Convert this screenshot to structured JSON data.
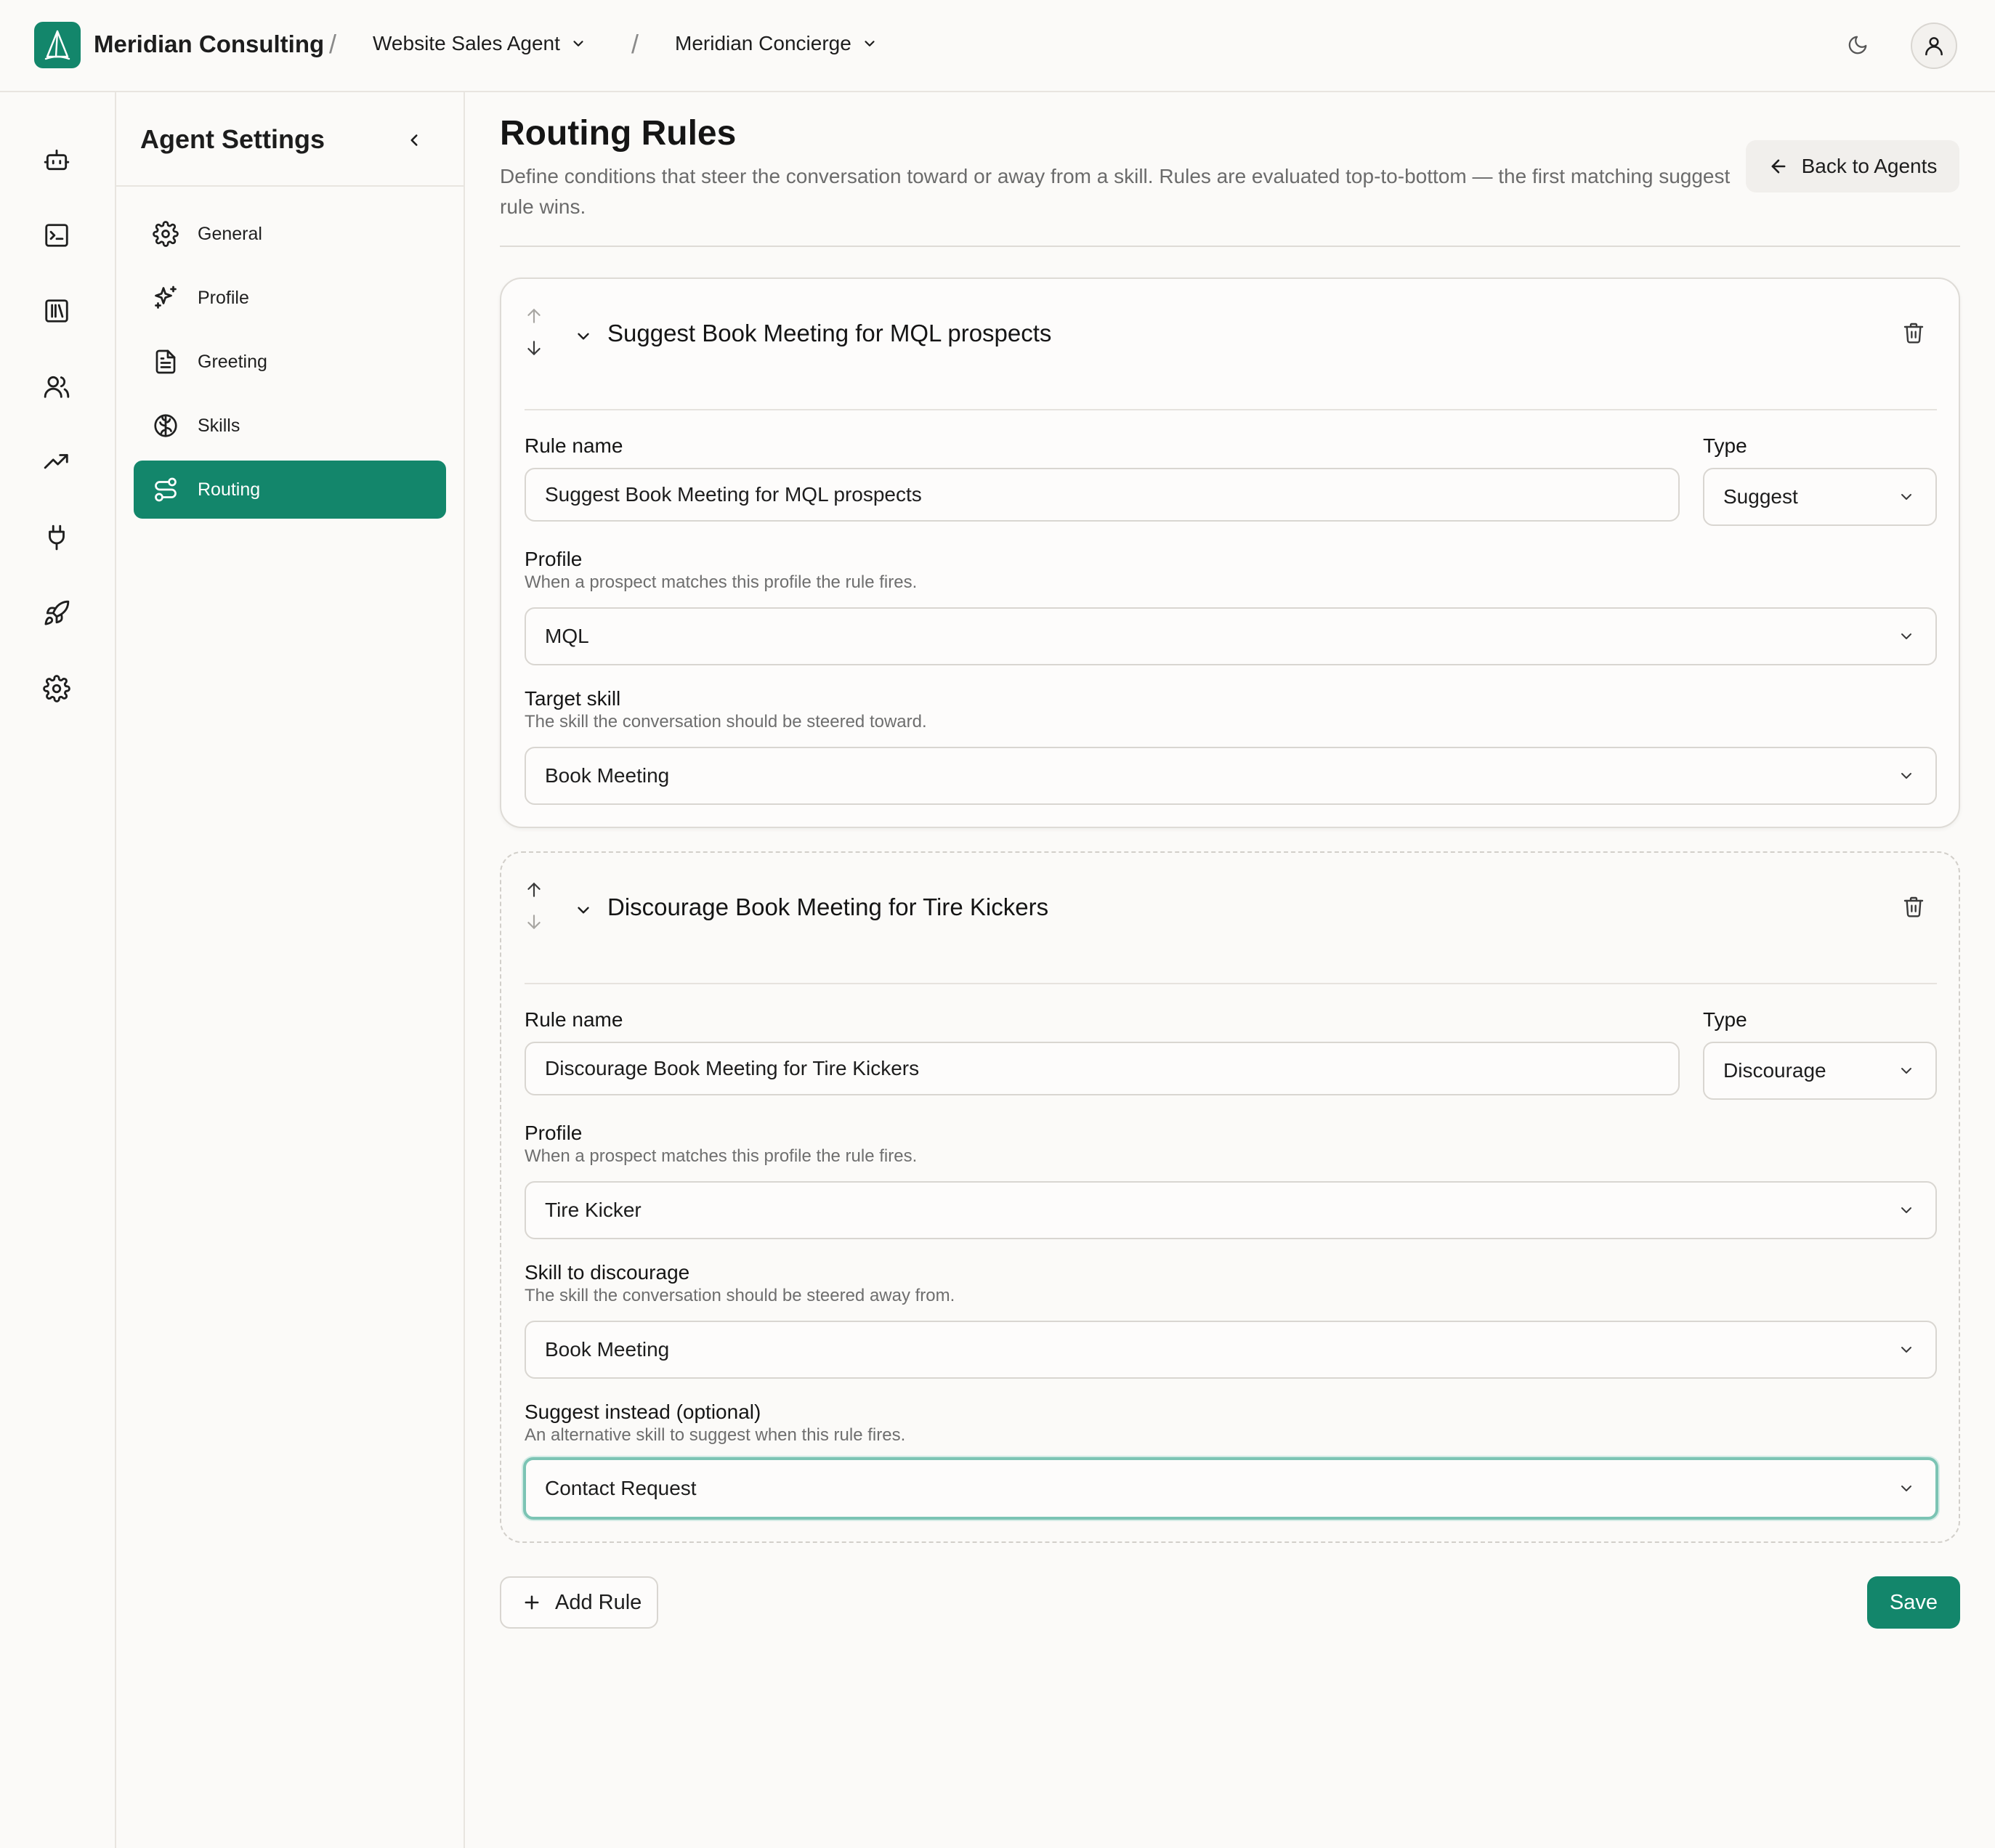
{
  "header": {
    "brand": "Meridian Consulting",
    "separator": "/",
    "agent_label": "Website Sales Agent",
    "concierge_label": "Meridian Concierge"
  },
  "rail": {
    "icons": [
      "bot-icon",
      "terminal-icon",
      "library-icon",
      "users-icon",
      "trending-up-icon",
      "plug-icon",
      "rocket-icon",
      "settings-icon"
    ]
  },
  "sidebar": {
    "title": "Agent Settings",
    "items": [
      {
        "label": "General",
        "icon": "gear-icon"
      },
      {
        "label": "Profile",
        "icon": "sparkles-icon"
      },
      {
        "label": "Greeting",
        "icon": "document-icon"
      },
      {
        "label": "Skills",
        "icon": "brain-icon"
      },
      {
        "label": "Routing",
        "icon": "route-icon",
        "active": true
      }
    ]
  },
  "main": {
    "title": "Routing Rules",
    "description": "Define conditions that steer the conversation toward or away from a skill. Rules are evaluated top-to-bottom — the first matching suggest rule wins.",
    "back_label": "Back to Agents",
    "rules": [
      {
        "title": "Suggest Book Meeting for MQL prospects",
        "rule_name_label": "Rule name",
        "rule_name_value": "Suggest Book Meeting for MQL prospects",
        "type_label": "Type",
        "type_value": "Suggest",
        "profile_label": "Profile",
        "profile_hint": "When a prospect matches this profile the rule fires.",
        "profile_value": "MQL",
        "skill_label": "Target skill",
        "skill_hint": "The skill the conversation should be steered toward.",
        "skill_value": "Book Meeting"
      },
      {
        "title": "Discourage Book Meeting for Tire Kickers",
        "rule_name_label": "Rule name",
        "rule_name_value": "Discourage Book Meeting for Tire Kickers",
        "type_label": "Type",
        "type_value": "Discourage",
        "profile_label": "Profile",
        "profile_hint": "When a prospect matches this profile the rule fires.",
        "profile_value": "Tire Kicker",
        "skill_label": "Skill to discourage",
        "skill_hint": "The skill the conversation should be steered away from.",
        "skill_value": "Book Meeting",
        "suggest_label": "Suggest instead (optional)",
        "suggest_hint": "An alternative skill to suggest when this rule fires.",
        "suggest_value": "Contact Request"
      }
    ],
    "add_rule_label": "Add Rule",
    "save_label": "Save"
  },
  "colors": {
    "accent": "#13866b",
    "focus_ring": "#7cc4b4",
    "background": "#fbfaf8"
  }
}
